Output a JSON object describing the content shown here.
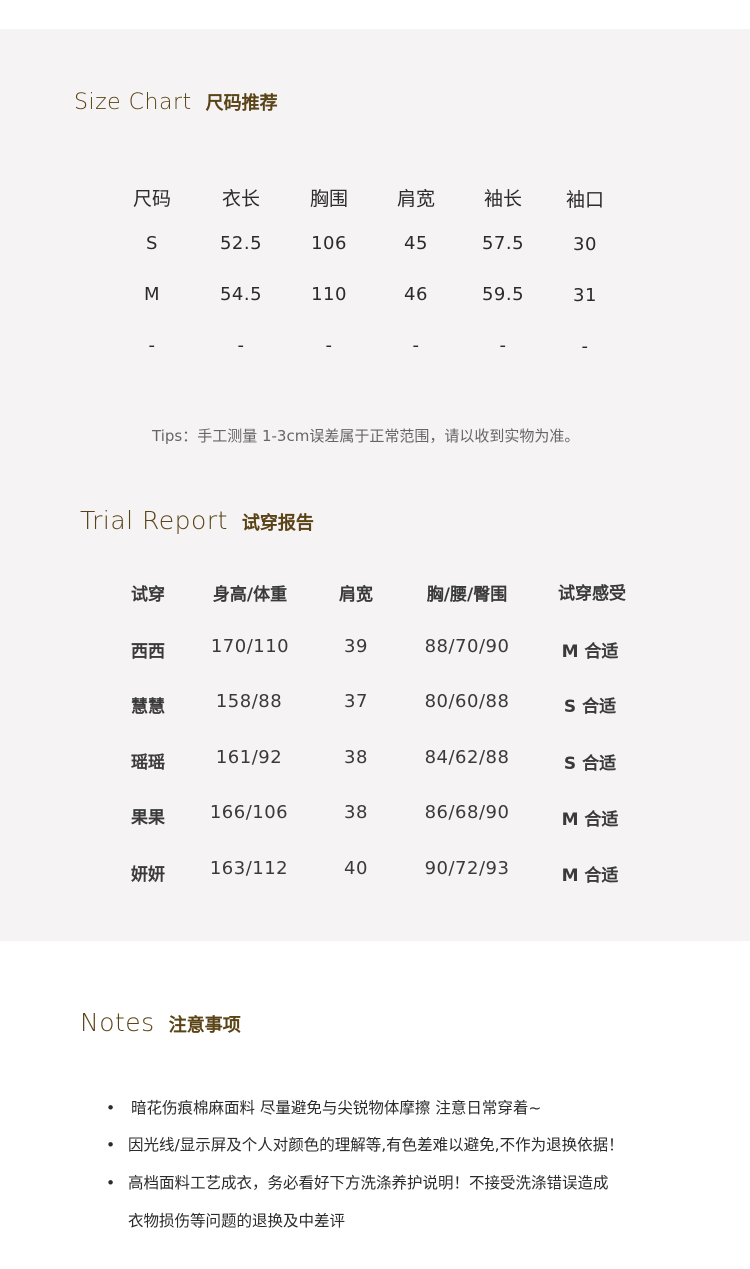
{
  "size_chart": {
    "title_en": "Size Chart",
    "title_cn": "尺码推荐",
    "headers": [
      "尺码",
      "衣长",
      "胸围",
      "肩宽",
      "袖长",
      "袖口"
    ],
    "rows": [
      [
        "S",
        "52.5",
        "106",
        "45",
        "57.5",
        "30"
      ],
      [
        "M",
        "54.5",
        "110",
        "46",
        "59.5",
        "31"
      ],
      [
        "-",
        "-",
        "-",
        "-",
        "-",
        "-"
      ]
    ],
    "tips": "Tips：手工测量 1-3cm误差属于正常范围，请以收到实物为准。"
  },
  "trial_report": {
    "title_en": "Trial Report",
    "title_cn": "试穿报告",
    "headers": [
      "试穿",
      "身高/体重",
      "肩宽",
      "胸/腰/臀围",
      "试穿感受"
    ],
    "rows": [
      [
        "西西",
        "170/110",
        "39",
        "88/70/90",
        "M 合适"
      ],
      [
        "慧慧",
        "158/88",
        "37",
        "80/60/88",
        "S 合适"
      ],
      [
        "瑶瑶",
        "161/92",
        "38",
        "84/62/88",
        "S 合适"
      ],
      [
        "果果",
        "166/106",
        "38",
        "86/68/90",
        "M 合适"
      ],
      [
        "妍妍",
        "163/112",
        "40",
        "90/72/93",
        "M 合适"
      ]
    ]
  },
  "notes": {
    "title_en": "Notes",
    "title_cn": "注意事项",
    "bullet": "•",
    "items": [
      "暗花伤痕棉麻面料 尽量避免与尖锐物体摩擦 注意日常穿着~",
      "因光线/显示屏及个人对颜色的理解等,有色差难以避免,不作为退换依据！",
      "高档面料工艺成衣，务必看好下方洗涤养护说明！不接受洗涤错误造成"
    ],
    "item3_continuation": "衣物损伤等问题的退换及中差评"
  },
  "colors": {
    "panel_bg": "#f5f3f3",
    "title_color": "#5a4316",
    "text_color": "#2b2b2b"
  }
}
